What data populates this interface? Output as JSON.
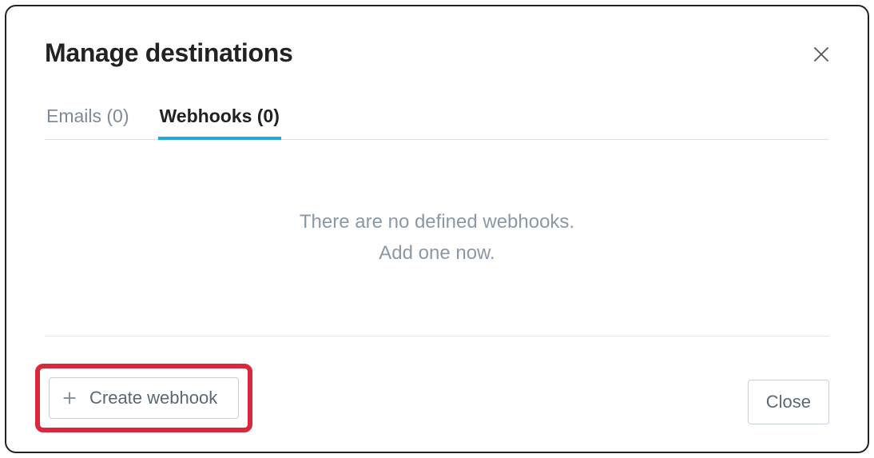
{
  "modal": {
    "title": "Manage destinations"
  },
  "tabs": {
    "emails": {
      "label": "Emails (0)"
    },
    "webhooks": {
      "label": "Webhooks (0)"
    }
  },
  "empty": {
    "line1": "There are no defined webhooks.",
    "line2": "Add one now."
  },
  "buttons": {
    "create": "Create webhook",
    "close": "Close"
  }
}
